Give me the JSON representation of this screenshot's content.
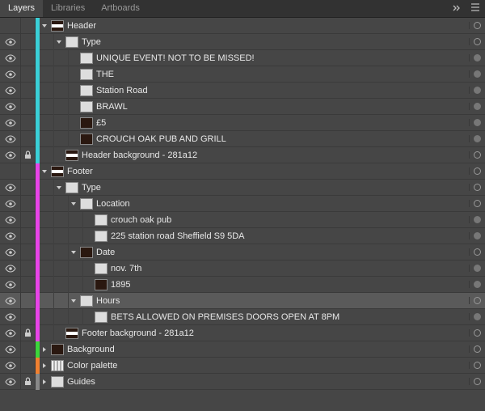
{
  "tabs": {
    "items": [
      "Layers",
      "Libraries",
      "Artboards"
    ],
    "active": 0
  },
  "colors": {
    "cyan": "#3ad0d8",
    "magenta": "#e844e8",
    "orange": "#f08030",
    "green": "#3bd63b",
    "blue": "#4a7ac8",
    "gold": "#c8a030",
    "gray": "#888888"
  },
  "rows": [
    {
      "d": 0,
      "sw": "cyan",
      "tw": "down",
      "th": "lines",
      "label": "Header",
      "noEye": true
    },
    {
      "d": 1,
      "sw": "cyan",
      "tw": "down",
      "th": "plain",
      "label": "Type"
    },
    {
      "d": 2,
      "sw": "cyan",
      "th": "plain",
      "label": "UNIQUE EVENT! NOT TO BE MISSED!",
      "filled": true
    },
    {
      "d": 2,
      "sw": "cyan",
      "th": "plain",
      "label": "THE",
      "filled": true
    },
    {
      "d": 2,
      "sw": "cyan",
      "th": "plain",
      "label": "Station Road",
      "filled": true
    },
    {
      "d": 2,
      "sw": "cyan",
      "th": "plain",
      "label": "BRAWL",
      "filled": true
    },
    {
      "d": 2,
      "sw": "cyan",
      "th": "dark",
      "label": "£5",
      "filled": true
    },
    {
      "d": 2,
      "sw": "cyan",
      "th": "dark",
      "label": "CROUCH OAK PUB AND GRILL",
      "filled": true
    },
    {
      "d": 1,
      "sw": "cyan",
      "th": "lines",
      "label": "Header background - 281a12",
      "locked": true
    },
    {
      "d": 0,
      "sw": "magenta",
      "tw": "down",
      "th": "lines",
      "label": "Footer",
      "noEye": true
    },
    {
      "d": 1,
      "sw": "magenta",
      "tw": "down",
      "th": "plain",
      "label": "Type"
    },
    {
      "d": 2,
      "sw": "magenta",
      "tw": "down",
      "th": "plain",
      "label": "Location"
    },
    {
      "d": 3,
      "sw": "magenta",
      "th": "plain",
      "label": "crouch oak pub",
      "filled": true
    },
    {
      "d": 3,
      "sw": "magenta",
      "th": "plain",
      "label": "225 station road Sheffield S9 5DA",
      "filled": true
    },
    {
      "d": 2,
      "sw": "magenta",
      "tw": "down",
      "th": "dark",
      "label": "Date"
    },
    {
      "d": 3,
      "sw": "magenta",
      "th": "plain",
      "label": "nov. 7th",
      "filled": true
    },
    {
      "d": 3,
      "sw": "magenta",
      "th": "dark",
      "label": "1895",
      "filled": true
    },
    {
      "d": 2,
      "sw": "magenta",
      "tw": "down",
      "th": "plain",
      "label": "Hours",
      "hl": true
    },
    {
      "d": 3,
      "sw": "magenta",
      "th": "plain",
      "label": "BETS ALLOWED ON PREMISES DOORS OPEN AT 8PM",
      "filled": true
    },
    {
      "d": 1,
      "sw": "magenta",
      "th": "lines",
      "label": "Footer background - 281a12",
      "locked": true
    },
    {
      "d": 0,
      "sw": "green",
      "tw": "right",
      "th": "dark",
      "label": "Background"
    },
    {
      "d": 0,
      "sw": "orange",
      "tw": "right",
      "th": "striped",
      "label": "Color palette"
    },
    {
      "d": 0,
      "sw": "gray",
      "tw": "right",
      "th": "plain",
      "label": "Guides",
      "locked": true
    }
  ]
}
